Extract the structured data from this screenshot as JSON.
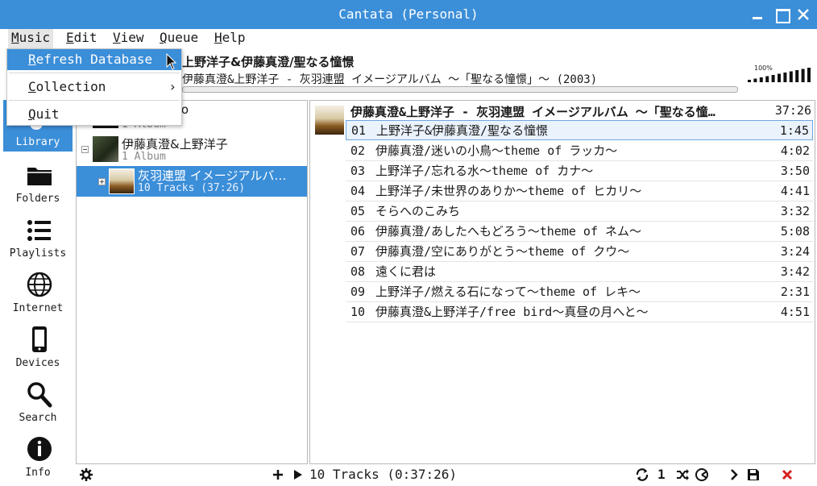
{
  "window": {
    "title": "Cantata (Personal)"
  },
  "menubar": {
    "items": [
      {
        "label": "Music",
        "key": "M",
        "rest": "usic"
      },
      {
        "label": "Edit",
        "key": "E",
        "rest": "dit"
      },
      {
        "label": "View",
        "key": "V",
        "rest": "iew"
      },
      {
        "label": "Queue",
        "key": "Q",
        "rest": "ueue"
      },
      {
        "label": "Help",
        "key": "H",
        "rest": "elp"
      }
    ]
  },
  "music_menu": {
    "items": [
      {
        "key": "R",
        "rest": "efresh Database"
      },
      {
        "key": "C",
        "rest": "ollection",
        "arrow": "›"
      },
      {
        "key": "Q",
        "rest": "uit"
      }
    ]
  },
  "now_playing": {
    "title": "上野洋子&伊藤真澄/聖なる憧憬",
    "subtitle": "伊藤真澄&上野洋子 - 灰羽連盟 イメージアルバム ～「聖なる憧憬」～ (2003)",
    "volume_label": "100%",
    "volume_fraction": 1.0
  },
  "sidebar": {
    "items": [
      {
        "label": "Library",
        "icon": "library-icon"
      },
      {
        "label": "Folders",
        "icon": "folder-icon"
      },
      {
        "label": "Playlists",
        "icon": "playlists-icon"
      },
      {
        "label": "Internet",
        "icon": "globe-icon"
      },
      {
        "label": "Devices",
        "icon": "phone-icon"
      },
      {
        "label": "Search",
        "icon": "search-icon"
      },
      {
        "label": "Info",
        "icon": "info-icon"
      }
    ]
  },
  "library": {
    "rows": [
      {
        "title": "ro",
        "subtitle": "1 Album"
      },
      {
        "title": "伊藤真澄&上野洋子",
        "subtitle": "1 Album"
      },
      {
        "title": "灰羽連盟 イメージアルバ…",
        "subtitle": "10 Tracks (37:26)"
      }
    ]
  },
  "playlist": {
    "header": "伊藤真澄&上野洋子 - 灰羽連盟 イメージアルバム ～「聖なる憧…",
    "header_time": "37:26",
    "tracks": [
      {
        "num": "01",
        "name": "上野洋子&伊藤真澄/聖なる憧憬",
        "dur": "1:45"
      },
      {
        "num": "02",
        "name": "伊藤真澄/迷いの小鳥～theme of ラッカ～",
        "dur": "4:02"
      },
      {
        "num": "03",
        "name": "上野洋子/忘れる水～theme of カナ～",
        "dur": "3:50"
      },
      {
        "num": "04",
        "name": "上野洋子/未世界のありか～theme of ヒカリ～",
        "dur": "4:41"
      },
      {
        "num": "05",
        "name": "そらへのこみち",
        "dur": "3:32"
      },
      {
        "num": "06",
        "name": "伊藤真澄/あしたへもどろう～theme of ネム～",
        "dur": "5:08"
      },
      {
        "num": "07",
        "name": "伊藤真澄/空にありがとう～theme of クウ～",
        "dur": "3:24"
      },
      {
        "num": "08",
        "name": "遠くに君は",
        "dur": "3:42"
      },
      {
        "num": "09",
        "name": "上野洋子/燃える石になって～theme of レキ～",
        "dur": "2:31"
      },
      {
        "num": "10",
        "name": "伊藤真澄&上野洋子/free bird～真昼の月へと～",
        "dur": "4:51"
      }
    ]
  },
  "bottombar": {
    "summary": "10 Tracks (0:37:26)",
    "single_label": "1"
  },
  "colors": {
    "accent": "#3b8ed8",
    "close_red": "#d62020"
  }
}
